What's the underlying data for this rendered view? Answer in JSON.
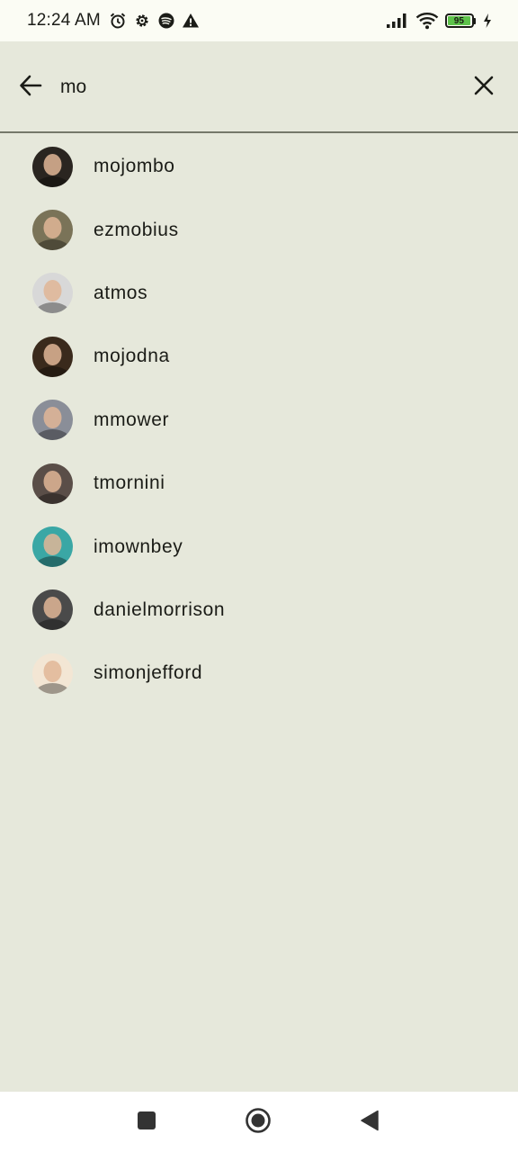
{
  "status_bar": {
    "time": "12:24 AM",
    "icons": [
      "alarm-icon",
      "settings-gear-icon",
      "spotify-icon",
      "warning-icon"
    ],
    "right_icons": [
      "signal-icon",
      "wifi-icon",
      "battery-icon",
      "charging-icon"
    ],
    "battery_level": "95",
    "battery_fraction": 0.95
  },
  "search": {
    "query": "mo",
    "back_icon": "arrow-back-icon",
    "clear_icon": "close-icon"
  },
  "results": [
    {
      "login": "mojombo",
      "avatar_color": "#2a2520"
    },
    {
      "login": "ezmobius",
      "avatar_color": "#7a7358"
    },
    {
      "login": "atmos",
      "avatar_color": "#d8d8d8"
    },
    {
      "login": "mojodna",
      "avatar_color": "#3a2a1c"
    },
    {
      "login": "mmower",
      "avatar_color": "#8a8e98"
    },
    {
      "login": "tmornini",
      "avatar_color": "#5a4e48"
    },
    {
      "login": "imownbey",
      "avatar_color": "#3aa7a5"
    },
    {
      "login": "danielmorrison",
      "avatar_color": "#4a4a4a"
    },
    {
      "login": "simonjefford",
      "avatar_color": "#f3e6d4"
    }
  ],
  "nav_bar": {
    "buttons": [
      "recents-square-icon",
      "home-circle-icon",
      "back-triangle-icon"
    ]
  }
}
